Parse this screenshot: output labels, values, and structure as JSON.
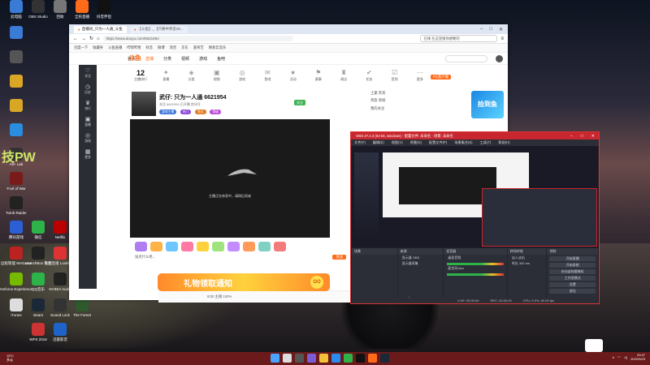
{
  "desktop": {
    "icons": [
      {
        "label": "此电脑",
        "color": "#3a7bd5"
      },
      {
        "label": "OBS Studio",
        "color": "#333"
      },
      {
        "label": "回收",
        "color": "#777"
      },
      {
        "label": "全民直播",
        "color": "#ff6b1a"
      },
      {
        "label": "抖音伴侣",
        "color": "#111"
      },
      {
        "label": "",
        "color": "#3a7bd5"
      },
      {
        "label": "",
        "color": "#555"
      },
      {
        "label": "",
        "color": "#d9a626"
      },
      {
        "label": "",
        "color": "#d9a626"
      },
      {
        "label": "",
        "color": "#2a8de0"
      },
      {
        "label": "Alt+ Lab",
        "color": "#333"
      },
      {
        "label": "Fool of War",
        "color": "#7a1a1a"
      },
      {
        "label": "Tomb Raider",
        "color": "#222"
      },
      {
        "label": "腾讯游戏",
        "color": "#2a5fd5"
      },
      {
        "label": "微信",
        "color": "#2db34a"
      },
      {
        "label": "Netflix",
        "color": "#b00"
      },
      {
        "label": "远程管理 WeGame",
        "color": "#b22"
      },
      {
        "label": "LaunchBox 平台",
        "color": "#222"
      },
      {
        "label": "远程连接 Lookbook",
        "color": "#d33"
      },
      {
        "label": "Geforce Experience",
        "color": "#76b900"
      },
      {
        "label": "QQ音乐",
        "color": "#2db34a"
      },
      {
        "label": "NVIDIA Audio",
        "color": "#222"
      },
      {
        "label": "iTunes",
        "color": "#ddd"
      },
      {
        "label": "steam",
        "color": "#1b2838"
      },
      {
        "label": "Sound Lock",
        "color": "#333"
      },
      {
        "label": "WPS 2019",
        "color": "#c33"
      },
      {
        "label": "迅雷影音",
        "color": "#1e64c8"
      },
      {
        "label": "The Forest",
        "color": "#2e5a2e"
      }
    ],
    "big_text": "技PW"
  },
  "browser": {
    "tabs": [
      {
        "label": "直播间_只为一人通_斗鱼",
        "active": true
      },
      {
        "label": "【斗鱼】_【只要中奖卖20...",
        "active": false
      }
    ],
    "url": "https://www.douyu.com/6621954",
    "search_placeholder": "在线 在这里搜你想要的",
    "bookmarks": [
      "百度一下",
      "收藏夹",
      "斗鱼直播",
      "哔哩哔哩",
      "抖音",
      "微博",
      "淘宝",
      "京东",
      "爱奇艺",
      "网易云音乐"
    ],
    "site_nav": [
      "首页",
      "直播",
      "分类",
      "视频",
      "游戏",
      "鱼吧"
    ],
    "site_logo": "斗鱼",
    "categories": [
      {
        "label": "主播排行",
        "value": "12"
      },
      {
        "label": "直播",
        "value": ""
      },
      {
        "label": "分类",
        "value": ""
      },
      {
        "label": "视频",
        "value": ""
      },
      {
        "label": "游戏",
        "value": ""
      },
      {
        "label": "鱼吧",
        "value": ""
      },
      {
        "label": "活动",
        "value": ""
      },
      {
        "label": "赛事",
        "value": ""
      },
      {
        "label": "周边",
        "value": ""
      },
      {
        "label": "任务",
        "value": ""
      },
      {
        "label": "签到",
        "value": ""
      },
      {
        "label": "更多",
        "value": ""
      }
    ],
    "streamer": {
      "name": "只为一人通",
      "room_id": "6621954",
      "prefix": "武仔:",
      "subtitle": "关注 6621954  已开播 房间号",
      "follow_label": "关注",
      "tags": [
        "游戏主播",
        "热门",
        "鱼丸",
        "等级"
      ]
    },
    "video_message": "主播正在休息中，请稍后再来",
    "chat_placeholder": "说点什么吧...",
    "send_label": "发送",
    "right_panel": {
      "line1": "土豪 贵宾",
      "line2": "贵族 周榜",
      "pc_btn": "PC客户端",
      "line3": "我的关注"
    },
    "promo_text": "捡到鱼",
    "banner_text": "礼物领取通知",
    "banner_go": "GO",
    "status_bar": "0/30  主播  100%"
  },
  "obs": {
    "title": "OBS 27.2.3 (64-bit, windows) - 配置文件: 未命名 - 场景: 未命名",
    "menu": [
      "文件(F)",
      "编辑(E)",
      "视图(V)",
      "停靠(D)",
      "配置文件(P)",
      "场景集合(S)",
      "工具(T)",
      "帮助(H)"
    ],
    "docks": {
      "scenes": {
        "title": "场景",
        "items": []
      },
      "sources": {
        "title": "来源",
        "items": [
          "显示器 OBS",
          "显示器采集"
        ]
      },
      "mixer": {
        "title": "混音器",
        "items": [
          "桌面音频",
          "麦克风/Aux"
        ]
      },
      "transitions": {
        "title": "转场特效",
        "items": [
          "淡入淡出",
          "时长 300 ms"
        ]
      },
      "controls": {
        "title": "控制",
        "items": [
          "开始直播",
          "开始录制",
          "启动虚拟摄像机",
          "工作室模式",
          "设置",
          "退出"
        ]
      }
    },
    "status": [
      "LIVE: 00:00:00",
      "REC: 00:00:00",
      "CPU: 5.9%, 60.00 fps"
    ]
  },
  "taskbar": {
    "weather_temp": "15°C",
    "weather_desc": "多云",
    "time": "20:47",
    "date": "2022/5/23"
  }
}
